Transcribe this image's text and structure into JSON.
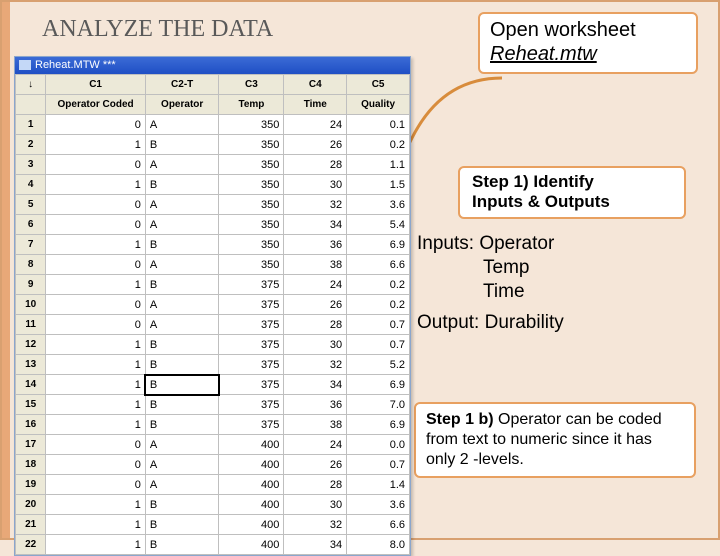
{
  "title": "ANALYZE THE DATA",
  "openBox": {
    "line1": "Open worksheet",
    "file": "Reheat.mtw"
  },
  "step1": {
    "l1": "Step 1) Identify",
    "l2": "Inputs & Outputs"
  },
  "io": {
    "inputsLabel": "Inputs: Operator",
    "in2": "Temp",
    "in3": "Time",
    "outputLabel": "Output:  Durability"
  },
  "step1b": "Step 1 b) Operator can be coded from text to numeric since it has only 2 -levels.",
  "ws": {
    "windowTitle": "Reheat.MTW ***",
    "cols": [
      "C1",
      "C2-T",
      "C3",
      "C4",
      "C5"
    ],
    "headers": [
      "Operator Coded",
      "Operator",
      "Temp",
      "Time",
      "Quality"
    ],
    "selected": {
      "row": 14,
      "col": 2
    },
    "rows": [
      {
        "n": 1,
        "c": [
          0,
          "A",
          350,
          24,
          "0.1"
        ]
      },
      {
        "n": 2,
        "c": [
          1,
          "B",
          350,
          26,
          "0.2"
        ]
      },
      {
        "n": 3,
        "c": [
          0,
          "A",
          350,
          28,
          "1.1"
        ]
      },
      {
        "n": 4,
        "c": [
          1,
          "B",
          350,
          30,
          "1.5"
        ]
      },
      {
        "n": 5,
        "c": [
          0,
          "A",
          350,
          32,
          "3.6"
        ]
      },
      {
        "n": 6,
        "c": [
          0,
          "A",
          350,
          34,
          "5.4"
        ]
      },
      {
        "n": 7,
        "c": [
          1,
          "B",
          350,
          36,
          "6.9"
        ]
      },
      {
        "n": 8,
        "c": [
          0,
          "A",
          350,
          38,
          "6.6"
        ]
      },
      {
        "n": 9,
        "c": [
          1,
          "B",
          375,
          24,
          "0.2"
        ]
      },
      {
        "n": 10,
        "c": [
          0,
          "A",
          375,
          26,
          "0.2"
        ]
      },
      {
        "n": 11,
        "c": [
          0,
          "A",
          375,
          28,
          "0.7"
        ]
      },
      {
        "n": 12,
        "c": [
          1,
          "B",
          375,
          30,
          "0.7"
        ]
      },
      {
        "n": 13,
        "c": [
          1,
          "B",
          375,
          32,
          "5.2"
        ]
      },
      {
        "n": 14,
        "c": [
          1,
          "B",
          375,
          34,
          "6.9"
        ]
      },
      {
        "n": 15,
        "c": [
          1,
          "B",
          375,
          36,
          "7.0"
        ]
      },
      {
        "n": 16,
        "c": [
          1,
          "B",
          375,
          38,
          "6.9"
        ]
      },
      {
        "n": 17,
        "c": [
          0,
          "A",
          400,
          24,
          "0.0"
        ]
      },
      {
        "n": 18,
        "c": [
          0,
          "A",
          400,
          26,
          "0.7"
        ]
      },
      {
        "n": 19,
        "c": [
          0,
          "A",
          400,
          28,
          "1.4"
        ]
      },
      {
        "n": 20,
        "c": [
          1,
          "B",
          400,
          30,
          "3.6"
        ]
      },
      {
        "n": 21,
        "c": [
          1,
          "B",
          400,
          32,
          "6.6"
        ]
      },
      {
        "n": 22,
        "c": [
          1,
          "B",
          400,
          34,
          "8.0"
        ]
      }
    ]
  }
}
